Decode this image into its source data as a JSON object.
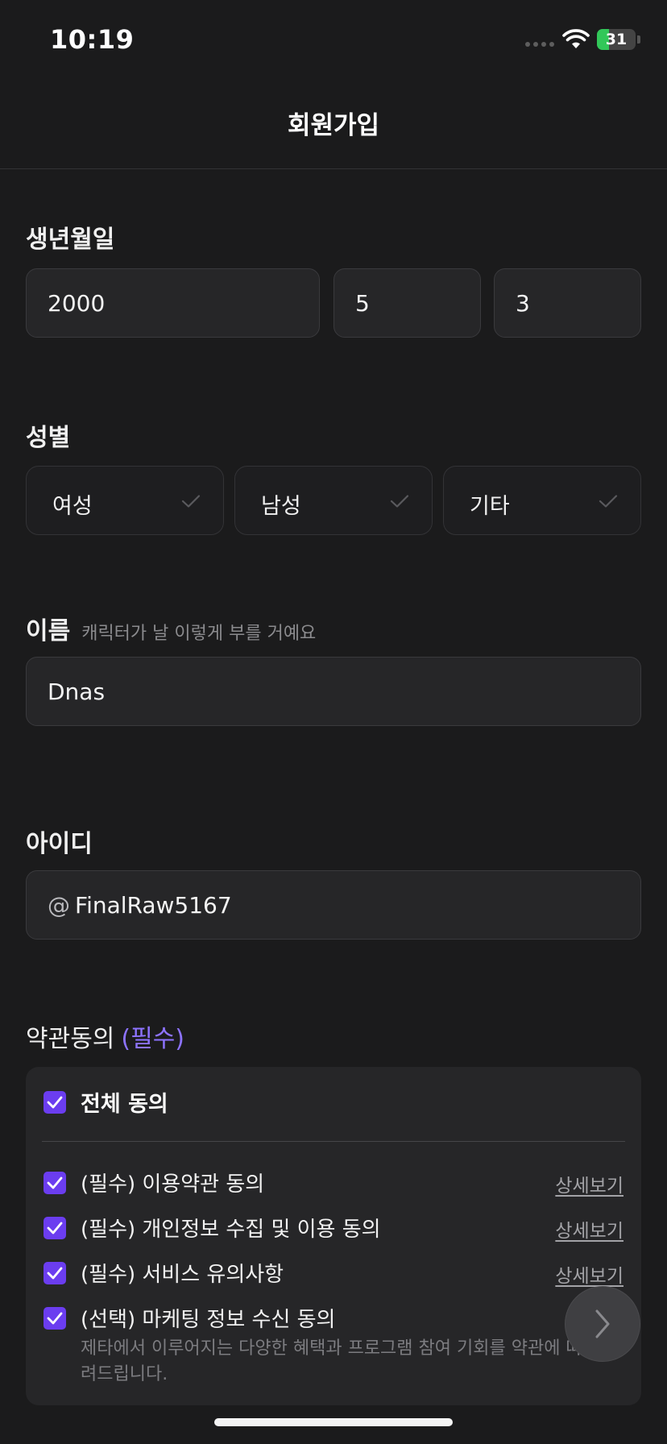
{
  "status": {
    "time": "10:19",
    "battery": "31",
    "battery_level": 0.31
  },
  "header": {
    "title": "회원가입"
  },
  "birthdate": {
    "label": "생년월일",
    "year": "2000",
    "month": "5",
    "day": "3"
  },
  "gender": {
    "label": "성별",
    "options": [
      "여성",
      "남성",
      "기타"
    ]
  },
  "name": {
    "label": "이름",
    "hint": "캐릭터가 날 이렇게 부를 거예요",
    "value": "Dnas"
  },
  "userid": {
    "label": "아이디",
    "prefix": "@",
    "value": "FinalRaw5167"
  },
  "terms": {
    "title": "약관동의",
    "required_tag": "(필수)",
    "all_label": "전체 동의",
    "items": [
      {
        "label": "(필수) 이용약관 동의",
        "detail": "상세보기",
        "checked": true
      },
      {
        "label": "(필수) 개인정보 수집 및 이용 동의",
        "detail": "상세보기",
        "checked": true
      },
      {
        "label": "(필수) 서비스 유의사항",
        "detail": "상세보기",
        "checked": true
      },
      {
        "label": "(선택) 마케팅 정보 수신 동의",
        "checked": true
      }
    ],
    "marketing_desc": "제타에서 이루어지는 다양한 혜택과 프로그램 참여 기회를 약관에 따려드립니다."
  },
  "colors": {
    "accent": "#6b3df0",
    "accent_text": "#8d73ff",
    "background": "#1b1b1c",
    "battery": "#32c759"
  },
  "icons": {
    "next": "chevron-right-icon",
    "check": "checkmark-icon",
    "wifi": "wifi-icon"
  }
}
